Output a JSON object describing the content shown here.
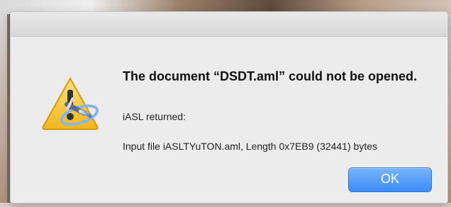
{
  "dialog": {
    "title": "The document “DSDT.aml” could not be opened.",
    "subtitle": "iASL returned:",
    "message": "Input file iASLTYuTON.aml, Length 0x7EB9 (32441) bytes",
    "ok_label": "OK",
    "icon": "warning-app-icon"
  },
  "colors": {
    "button": "#3c8cf5",
    "warning": "#f2c526"
  }
}
